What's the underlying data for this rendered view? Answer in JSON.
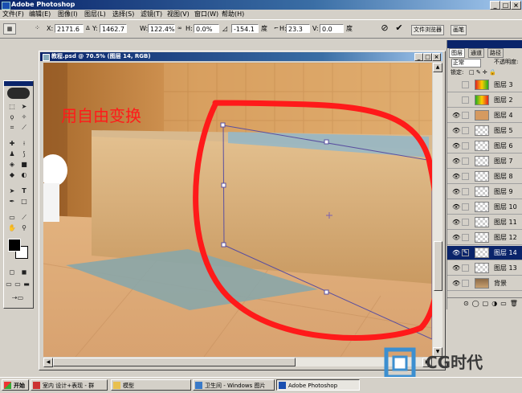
{
  "app": {
    "title": "Adobe Photoshop"
  },
  "menu": [
    "文件(F)",
    "编辑(E)",
    "图像(I)",
    "图层(L)",
    "选择(S)",
    "滤镜(T)",
    "视图(V)",
    "窗口(W)",
    "帮助(H)"
  ],
  "options": {
    "x_label": "X:",
    "x_value": "2171.6",
    "y_label": "Y:",
    "y_value": "1462.7",
    "w_label": "W:",
    "w_value": "122.4%",
    "h_label": "H:",
    "h_value": "0.0%",
    "angle_value": "-154.1",
    "deg": "度",
    "hskew_label": "H:",
    "hskew_value": "23.3",
    "vskew_label": "V:",
    "vskew_value": "0.0",
    "deg2": "度",
    "file_browser_tab": "文件浏览器",
    "brushes_tab": "画笔"
  },
  "document": {
    "title": "教程.psd @ 70.5% (图层 14, RGB)"
  },
  "annotation": "用自由变换",
  "watermark": "CG时代",
  "layers_panel": {
    "tabs": [
      "图层",
      "通道",
      "路径"
    ],
    "blend_mode": "正常",
    "opacity_label": "不透明度:",
    "lock_label": "锁定:",
    "layers": [
      {
        "name": "图层 3",
        "visible": false,
        "selected": false
      },
      {
        "name": "图层 2",
        "visible": false,
        "selected": false
      },
      {
        "name": "图层 4",
        "visible": true,
        "selected": false
      },
      {
        "name": "图层 5",
        "visible": true,
        "selected": false
      },
      {
        "name": "图层 6",
        "visible": true,
        "selected": false
      },
      {
        "name": "图层 7",
        "visible": true,
        "selected": false
      },
      {
        "name": "图层 8",
        "visible": true,
        "selected": false
      },
      {
        "name": "图层 9",
        "visible": true,
        "selected": false
      },
      {
        "name": "图层 10",
        "visible": true,
        "selected": false
      },
      {
        "name": "图层 11",
        "visible": true,
        "selected": false
      },
      {
        "name": "图层 12",
        "visible": true,
        "selected": false
      },
      {
        "name": "图层 14",
        "visible": true,
        "selected": true
      },
      {
        "name": "图层 13",
        "visible": true,
        "selected": false
      },
      {
        "name": "背景",
        "visible": true,
        "selected": false
      }
    ]
  },
  "taskbar": {
    "start": "开始",
    "tasks": [
      "室内 设计+表现 - 群",
      "模型",
      "卫生间 - Windows 图片",
      "Adobe Photoshop"
    ]
  },
  "colors": {
    "titlebar": "#0a246a",
    "annotation": "#ff1a1a",
    "transform_box": "#5a4fa0"
  }
}
